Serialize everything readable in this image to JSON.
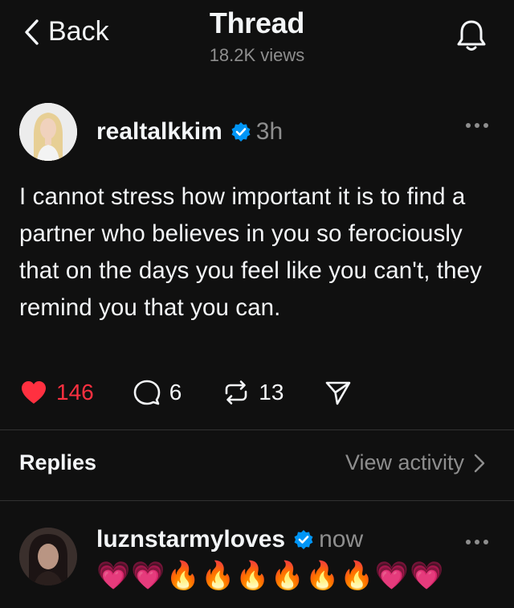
{
  "header": {
    "back_label": "Back",
    "title": "Thread",
    "views": "18.2K views",
    "back_icon": "chevron-left-icon",
    "notification_icon": "bell-icon"
  },
  "post": {
    "username": "realtalkkim",
    "time": "3h",
    "verified": true,
    "text": "I cannot stress how important it is to find a partner who believes in you so ferociously that on the days you feel like you can't, they remind you that you can.",
    "likes": "146",
    "comments": "6",
    "reposts": "13",
    "liked": true,
    "like_color": "#ff3040"
  },
  "replies_section": {
    "label": "Replies",
    "view_activity": "View activity"
  },
  "reply": {
    "username": "luznstarmyloves",
    "time": "now",
    "verified": true,
    "text": "💗💗🔥🔥🔥🔥🔥🔥💗💗"
  },
  "colors": {
    "background": "#101010",
    "text": "#f3f5f7",
    "secondary": "#8e8e8e",
    "verified": "#0095f6",
    "divider": "#323232"
  }
}
